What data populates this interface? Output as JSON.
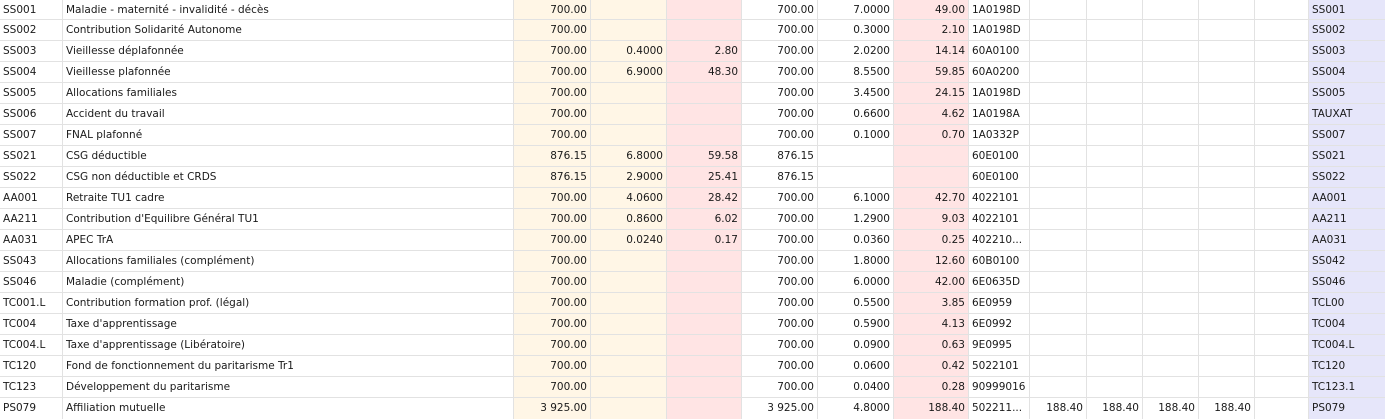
{
  "rows": [
    {
      "code": "SS001",
      "label": "Maladie - maternité - invalidité - décès",
      "base": "700.00",
      "sal_rate": "",
      "sal_amount": "",
      "pat_base": "700.00",
      "pat_rate": "7.0000",
      "pat_amount": "49.00",
      "account": "1A0198D",
      "m1": "",
      "m2": "",
      "m3": "",
      "m4": "",
      "m5": "",
      "ref": "SS001"
    },
    {
      "code": "SS002",
      "label": "Contribution Solidarité Autonome",
      "base": "700.00",
      "sal_rate": "",
      "sal_amount": "",
      "pat_base": "700.00",
      "pat_rate": "0.3000",
      "pat_amount": "2.10",
      "account": "1A0198D",
      "m1": "",
      "m2": "",
      "m3": "",
      "m4": "",
      "m5": "",
      "ref": "SS002"
    },
    {
      "code": "SS003",
      "label": "Vieillesse déplafonnée",
      "base": "700.00",
      "sal_rate": "0.4000",
      "sal_amount": "2.80",
      "pat_base": "700.00",
      "pat_rate": "2.0200",
      "pat_amount": "14.14",
      "account": "60A0100",
      "m1": "",
      "m2": "",
      "m3": "",
      "m4": "",
      "m5": "",
      "ref": "SS003"
    },
    {
      "code": "SS004",
      "label": "Vieillesse plafonnée",
      "base": "700.00",
      "sal_rate": "6.9000",
      "sal_amount": "48.30",
      "pat_base": "700.00",
      "pat_rate": "8.5500",
      "pat_amount": "59.85",
      "account": "60A0200",
      "m1": "",
      "m2": "",
      "m3": "",
      "m4": "",
      "m5": "",
      "ref": "SS004"
    },
    {
      "code": "SS005",
      "label": "Allocations familiales",
      "base": "700.00",
      "sal_rate": "",
      "sal_amount": "",
      "pat_base": "700.00",
      "pat_rate": "3.4500",
      "pat_amount": "24.15",
      "account": "1A0198D",
      "m1": "",
      "m2": "",
      "m3": "",
      "m4": "",
      "m5": "",
      "ref": "SS005"
    },
    {
      "code": "SS006",
      "label": "Accident du travail",
      "base": "700.00",
      "sal_rate": "",
      "sal_amount": "",
      "pat_base": "700.00",
      "pat_rate": "0.6600",
      "pat_amount": "4.62",
      "account": "1A0198A",
      "m1": "",
      "m2": "",
      "m3": "",
      "m4": "",
      "m5": "",
      "ref": "TAUXAT"
    },
    {
      "code": "SS007",
      "label": "FNAL plafonné",
      "base": "700.00",
      "sal_rate": "",
      "sal_amount": "",
      "pat_base": "700.00",
      "pat_rate": "0.1000",
      "pat_amount": "0.70",
      "account": "1A0332P",
      "m1": "",
      "m2": "",
      "m3": "",
      "m4": "",
      "m5": "",
      "ref": "SS007"
    },
    {
      "code": "SS021",
      "label": "CSG déductible",
      "base": "876.15",
      "sal_rate": "6.8000",
      "sal_amount": "59.58",
      "pat_base": "876.15",
      "pat_rate": "",
      "pat_amount": "",
      "account": "60E0100",
      "m1": "",
      "m2": "",
      "m3": "",
      "m4": "",
      "m5": "",
      "ref": "SS021"
    },
    {
      "code": "SS022",
      "label": "CSG non déductible et CRDS",
      "base": "876.15",
      "sal_rate": "2.9000",
      "sal_amount": "25.41",
      "pat_base": "876.15",
      "pat_rate": "",
      "pat_amount": "",
      "account": "60E0100",
      "m1": "",
      "m2": "",
      "m3": "",
      "m4": "",
      "m5": "",
      "ref": "SS022"
    },
    {
      "code": "AA001",
      "label": "Retraite TU1 cadre",
      "base": "700.00",
      "sal_rate": "4.0600",
      "sal_amount": "28.42",
      "pat_base": "700.00",
      "pat_rate": "6.1000",
      "pat_amount": "42.70",
      "account": "4022101",
      "m1": "",
      "m2": "",
      "m3": "",
      "m4": "",
      "m5": "",
      "ref": "AA001"
    },
    {
      "code": "AA211",
      "label": "Contribution d'Equilibre Général TU1",
      "base": "700.00",
      "sal_rate": "0.8600",
      "sal_amount": "6.02",
      "pat_base": "700.00",
      "pat_rate": "1.2900",
      "pat_amount": "9.03",
      "account": "4022101",
      "m1": "",
      "m2": "",
      "m3": "",
      "m4": "",
      "m5": "",
      "ref": "AA211"
    },
    {
      "code": "AA031",
      "label": "APEC TrA",
      "base": "700.00",
      "sal_rate": "0.0240",
      "sal_amount": "0.17",
      "pat_base": "700.00",
      "pat_rate": "0.0360",
      "pat_amount": "0.25",
      "account": "402210...",
      "m1": "",
      "m2": "",
      "m3": "",
      "m4": "",
      "m5": "",
      "ref": "AA031"
    },
    {
      "code": "SS043",
      "label": "Allocations familiales (complément)",
      "base": "700.00",
      "sal_rate": "",
      "sal_amount": "",
      "pat_base": "700.00",
      "pat_rate": "1.8000",
      "pat_amount": "12.60",
      "account": "60B0100",
      "m1": "",
      "m2": "",
      "m3": "",
      "m4": "",
      "m5": "",
      "ref": "SS042"
    },
    {
      "code": "SS046",
      "label": "Maladie (complément)",
      "base": "700.00",
      "sal_rate": "",
      "sal_amount": "",
      "pat_base": "700.00",
      "pat_rate": "6.0000",
      "pat_amount": "42.00",
      "account": "6E0635D",
      "m1": "",
      "m2": "",
      "m3": "",
      "m4": "",
      "m5": "",
      "ref": "SS046"
    },
    {
      "code": "TC001.L",
      "label": "Contribution formation prof. (légal)",
      "base": "700.00",
      "sal_rate": "",
      "sal_amount": "",
      "pat_base": "700.00",
      "pat_rate": "0.5500",
      "pat_amount": "3.85",
      "account": "6E0959",
      "m1": "",
      "m2": "",
      "m3": "",
      "m4": "",
      "m5": "",
      "ref": "TCL00"
    },
    {
      "code": "TC004",
      "label": "Taxe d'apprentissage",
      "base": "700.00",
      "sal_rate": "",
      "sal_amount": "",
      "pat_base": "700.00",
      "pat_rate": "0.5900",
      "pat_amount": "4.13",
      "account": "6E0992",
      "m1": "",
      "m2": "",
      "m3": "",
      "m4": "",
      "m5": "",
      "ref": "TC004"
    },
    {
      "code": "TC004.L",
      "label": "Taxe d'apprentissage (Libératoire)",
      "base": "700.00",
      "sal_rate": "",
      "sal_amount": "",
      "pat_base": "700.00",
      "pat_rate": "0.0900",
      "pat_amount": "0.63",
      "account": "9E0995",
      "m1": "",
      "m2": "",
      "m3": "",
      "m4": "",
      "m5": "",
      "ref": "TC004.L"
    },
    {
      "code": "TC120",
      "label": "Fond de fonctionnement du paritarisme Tr1",
      "base": "700.00",
      "sal_rate": "",
      "sal_amount": "",
      "pat_base": "700.00",
      "pat_rate": "0.0600",
      "pat_amount": "0.42",
      "account": "5022101",
      "m1": "",
      "m2": "",
      "m3": "",
      "m4": "",
      "m5": "",
      "ref": "TC120"
    },
    {
      "code": "TC123",
      "label": "Développement du paritarisme",
      "base": "700.00",
      "sal_rate": "",
      "sal_amount": "",
      "pat_base": "700.00",
      "pat_rate": "0.0400",
      "pat_amount": "0.28",
      "account": "90999016",
      "m1": "",
      "m2": "",
      "m3": "",
      "m4": "",
      "m5": "",
      "ref": "TC123.1"
    },
    {
      "code": "PS079",
      "label": "Affiliation mutuelle",
      "base": "3 925.00",
      "sal_rate": "",
      "sal_amount": "",
      "pat_base": "3 925.00",
      "pat_rate": "4.8000",
      "pat_amount": "188.40",
      "account": "502211...",
      "m1": "188.40",
      "m2": "188.40",
      "m3": "188.40",
      "m4": "188.40",
      "m5": "",
      "ref": "PS079"
    }
  ]
}
